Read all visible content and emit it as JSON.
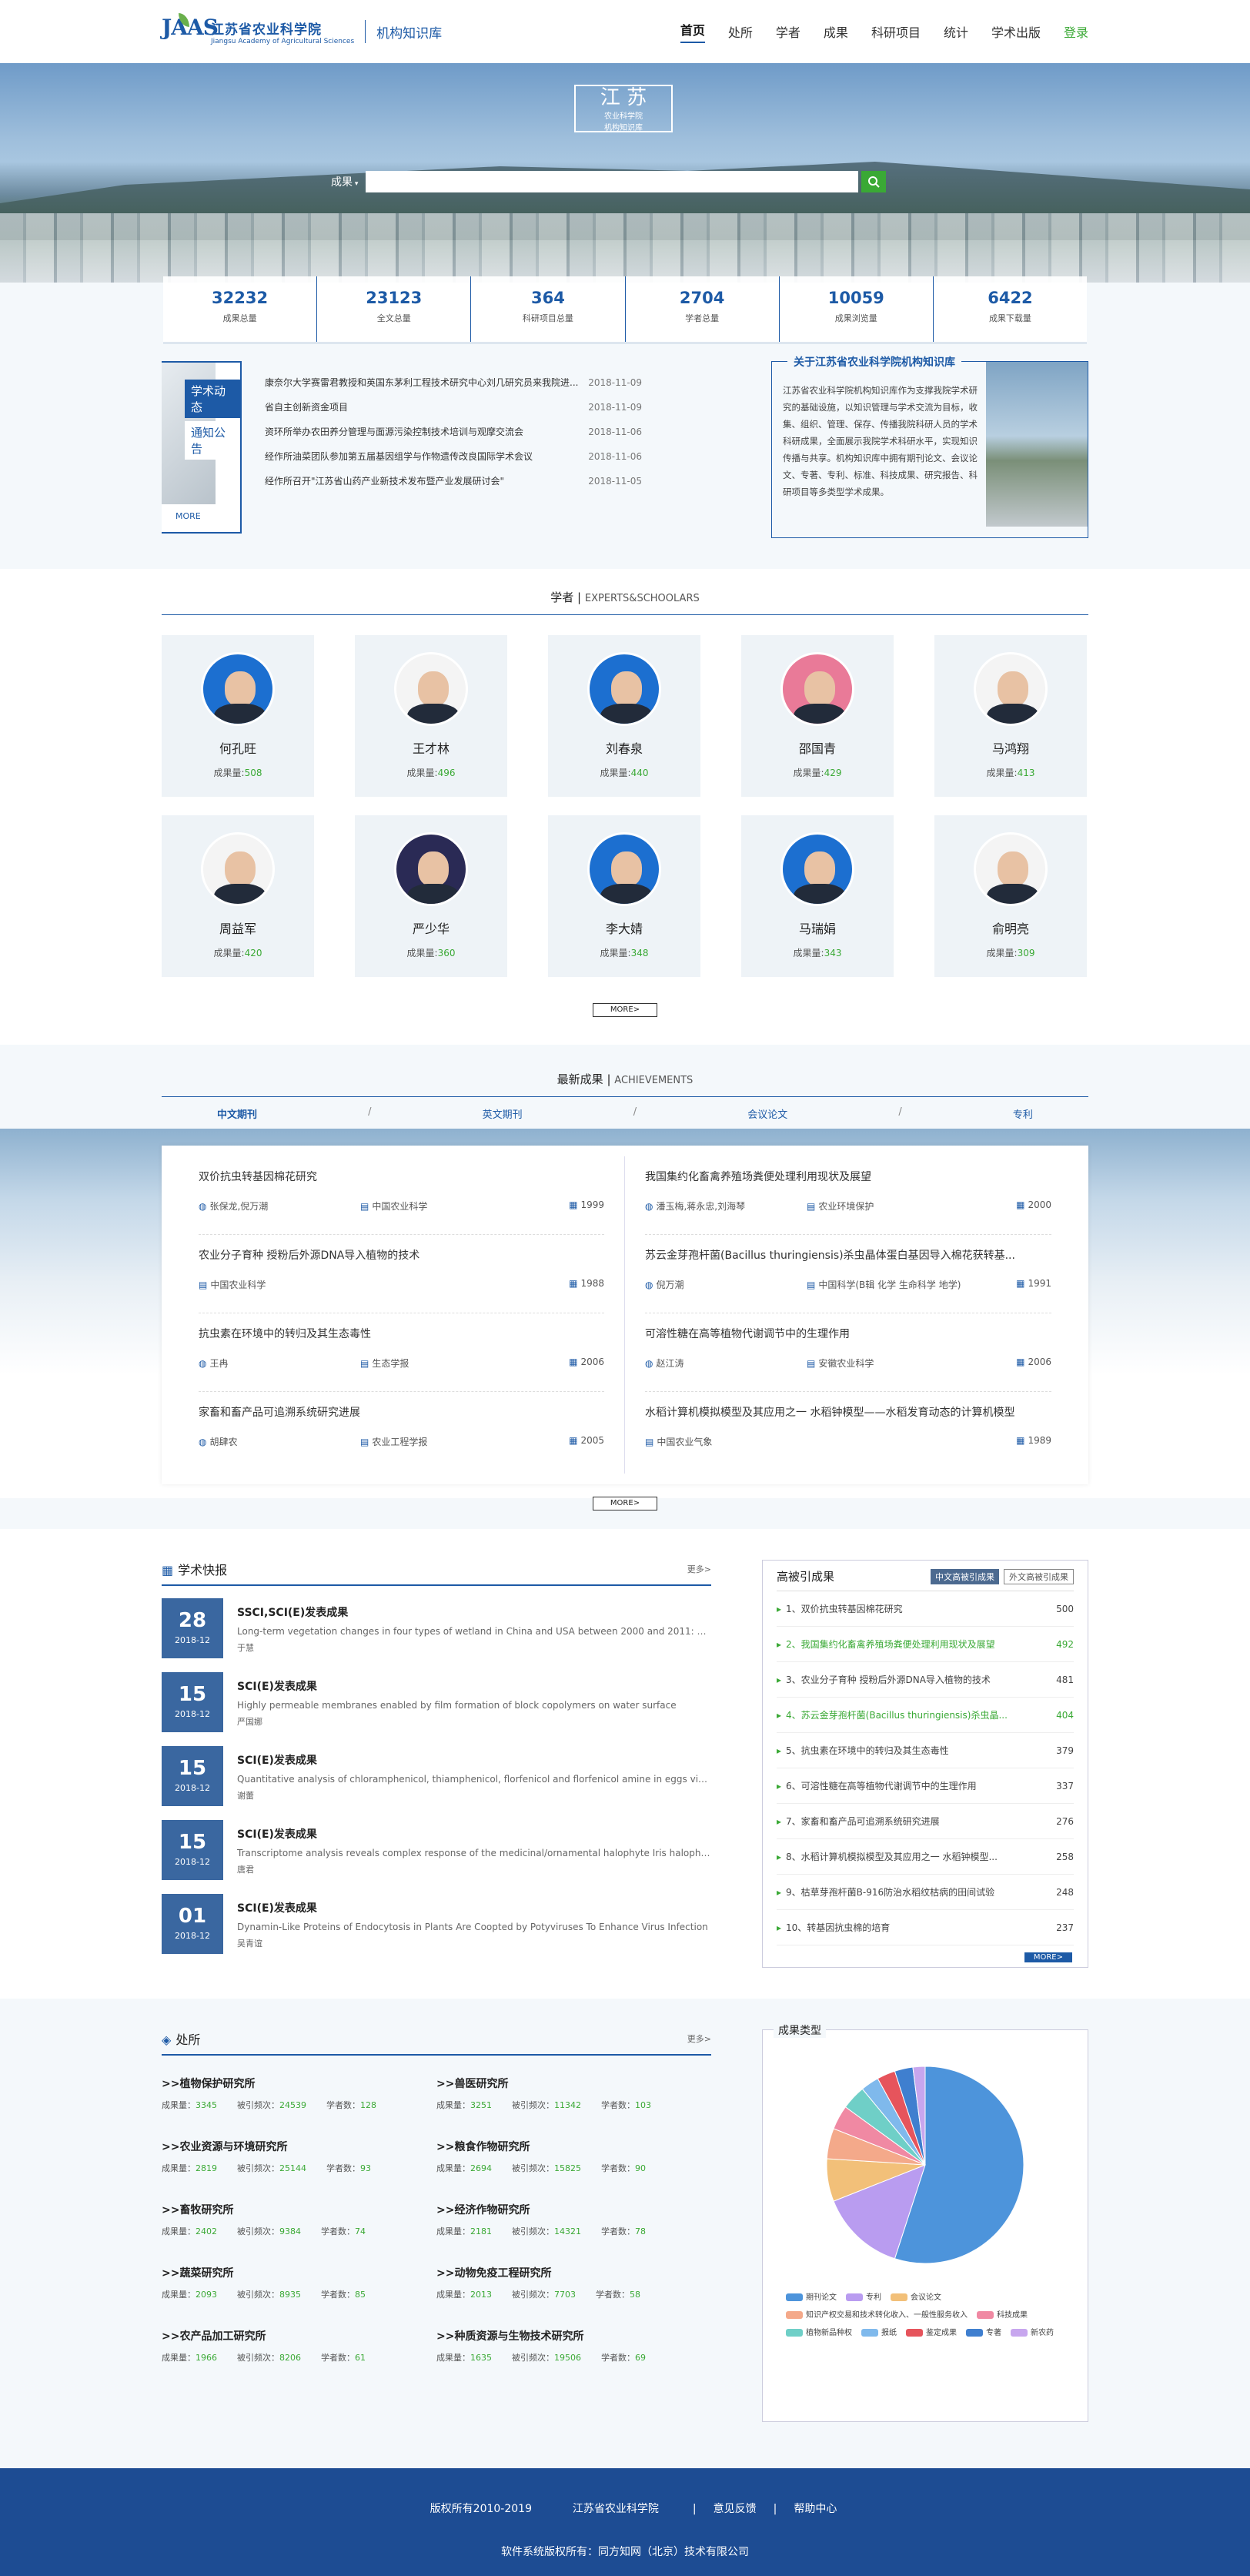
{
  "header": {
    "logo_mark": "JAAS",
    "logo_cn": "江苏省农业科学院",
    "logo_en": "Jiangsu Academy of Agricultural Sciences",
    "kb_name": "机构知识库",
    "nav": [
      "首页",
      "处所",
      "学者",
      "成果",
      "科研项目",
      "统计",
      "学术出版",
      "登录"
    ]
  },
  "banner": {
    "seal_main": "江  苏",
    "seal_sub1": "农业科学院",
    "seal_sub2": "机构知识库",
    "search_label": "成果",
    "search_placeholder": ""
  },
  "stats": [
    {
      "num": "32232",
      "label": "成果总量"
    },
    {
      "num": "23123",
      "label": "全文总量"
    },
    {
      "num": "364",
      "label": "科研项目总量"
    },
    {
      "num": "2704",
      "label": "学者总量"
    },
    {
      "num": "10059",
      "label": "成果浏览量"
    },
    {
      "num": "6422",
      "label": "成果下载量"
    }
  ],
  "news": {
    "tab1": "学术动态",
    "tab2": "通知公告",
    "more": "MORE",
    "items": [
      {
        "t": "康奈尔大学赛雷君教授和英国东茅利工程技术研究中心刘几研究员来我院进...",
        "d": "2018-11-09"
      },
      {
        "t": "省自主创新资金项目",
        "d": "2018-11-09"
      },
      {
        "t": "资环所举办农田养分管理与面源污染控制技术培训与观摩交流会",
        "d": "2018-11-06"
      },
      {
        "t": "经作所油菜团队参加第五届基因组学与作物遗传改良国际学术会议",
        "d": "2018-11-06"
      },
      {
        "t": "经作所召开\"江苏省山药产业新技术发布暨产业发展研讨会\"",
        "d": "2018-11-05"
      }
    ]
  },
  "about": {
    "title": "关于江苏省农业科学院机构知识库",
    "text": "江苏省农业科学院机构知识库作为支撑我院学术研究的基础设施，以知识管理与学术交流为目标，收集、组织、管理、保存、传播我院科研人员的学术科研成果，全面展示我院学术科研水平，实现知识传播与共享。机构知识库中拥有期刊论文、会议论文、专著、专利、标准、科技成果、研究报告、科研项目等多类型学术成果。"
  },
  "experts": {
    "title": "学者",
    "title_en": "EXPERTS&SCHOOLARS",
    "count_label": "成果量:",
    "more": "MORE>",
    "items": [
      {
        "name": "何孔旺",
        "count": "508"
      },
      {
        "name": "王才林",
        "count": "496"
      },
      {
        "name": "刘春泉",
        "count": "440"
      },
      {
        "name": "邵国青",
        "count": "429"
      },
      {
        "name": "马鸿翔",
        "count": "413"
      },
      {
        "name": "周益军",
        "count": "420"
      },
      {
        "name": "严少华",
        "count": "360"
      },
      {
        "name": "李大婧",
        "count": "348"
      },
      {
        "name": "马瑞娟",
        "count": "343"
      },
      {
        "name": "俞明亮",
        "count": "309"
      }
    ]
  },
  "achievements": {
    "title": "最新成果",
    "title_en": "ACHIEVEMENTS",
    "tabs": [
      "中文期刊",
      "英文期刊",
      "会议论文",
      "专利"
    ],
    "more": "MORE>",
    "left": [
      {
        "t": "双价抗虫转基因棉花研究",
        "au": "张保龙,倪万潮",
        "jr": "中国农业科学",
        "yr": "1999"
      },
      {
        "t": "农业分子育种 授粉后外源DNA导入植物的技术",
        "au": "",
        "jr": "中国农业科学",
        "yr": "1988"
      },
      {
        "t": "抗虫素在环境中的转归及其生态毒性",
        "au": "王冉",
        "jr": "生态学报",
        "yr": "2006"
      },
      {
        "t": "家畜和畜产品可追溯系统研究进展",
        "au": "胡肆农",
        "jr": "农业工程学报",
        "yr": "2005"
      }
    ],
    "right": [
      {
        "t": "我国集约化畜禽养殖场粪便处理利用现状及展望",
        "au": "潘玉梅,蒋永忠,刘海琴",
        "jr": "农业环境保护",
        "yr": "2000"
      },
      {
        "t": "苏云金芽孢杆菌(Bacillus thuringiensis)杀虫晶体蛋白基因导入棉花获转基...",
        "au": "倪万潮",
        "jr": "中国科学(B辑 化学 生命科学 地学)",
        "yr": "1991"
      },
      {
        "t": "可溶性糖在高等植物代谢调节中的生理作用",
        "au": "赵江涛",
        "jr": "安徽农业科学",
        "yr": "2006"
      },
      {
        "t": "水稻计算机模拟模型及其应用之一 水稻钟模型——水稻发育动态的计算机模型",
        "au": "",
        "jr": "中国农业气象",
        "yr": "1989"
      }
    ]
  },
  "bulletin": {
    "title": "学术快报",
    "more": "更多>",
    "items": [
      {
        "dd": "28",
        "ym": "2018-12",
        "h": "SSCI,SCI(E)发表成果",
        "p": "Long-term vegetation changes in four types of wetland in China and USA between 2000 and 2011: Ob...",
        "a": "于慧"
      },
      {
        "dd": "15",
        "ym": "2018-12",
        "h": "SCI(E)发表成果",
        "p": "Highly permeable membranes enabled by film formation of block copolymers on water surface",
        "a": "严国娜"
      },
      {
        "dd": "15",
        "ym": "2018-12",
        "h": "SCI(E)发表成果",
        "p": "Quantitative analysis of chloramphenicol, thiamphenicol, florfenicol and florfenicol amine in eggs via li...",
        "a": "谢蕾"
      },
      {
        "dd": "15",
        "ym": "2018-12",
        "h": "SCI(E)发表成果",
        "p": "Transcriptome analysis reveals complex response of the medicinal/ornamental halophyte Iris halophil...",
        "a": "唐君"
      },
      {
        "dd": "01",
        "ym": "2018-12",
        "h": "SCI(E)发表成果",
        "p": "Dynamin-Like Proteins of Endocytosis in Plants Are Coopted by Potyviruses To Enhance Virus Infection",
        "a": "吴青谊"
      }
    ]
  },
  "cited": {
    "title": "高被引成果",
    "tab1": "中文高被引成果",
    "tab2": "外文高被引成果",
    "more": "MORE>",
    "items": [
      {
        "n": "1、双价抗虫转基因棉花研究",
        "v": "500"
      },
      {
        "n": "2、我国集约化畜禽养殖场粪便处理利用现状及展望",
        "v": "492"
      },
      {
        "n": "3、农业分子育种 授粉后外源DNA导入植物的技术",
        "v": "481"
      },
      {
        "n": "4、苏云金芽孢杆菌(Bacillus thuringiensis)杀虫晶...",
        "v": "404"
      },
      {
        "n": "5、抗虫素在环境中的转归及其生态毒性",
        "v": "379"
      },
      {
        "n": "6、可溶性糖在高等植物代谢调节中的生理作用",
        "v": "337"
      },
      {
        "n": "7、家畜和畜产品可追溯系统研究进展",
        "v": "276"
      },
      {
        "n": "8、水稻计算机模拟模型及其应用之一 水稻钟模型...",
        "v": "258"
      },
      {
        "n": "9、枯草芽孢杆菌B-916防治水稻纹枯病的田间试验",
        "v": "248"
      },
      {
        "n": "10、转基因抗虫棉的培育",
        "v": "237"
      }
    ]
  },
  "departments": {
    "title": "处所",
    "more": "更多>",
    "l_count": "成果量：",
    "l_cited": "被引频次：",
    "l_scholars": "学者数：",
    "items": [
      {
        "n": ">>植物保护研究所",
        "c": "3345",
        "ci": "24539",
        "s": "128"
      },
      {
        "n": ">>兽医研究所",
        "c": "3251",
        "ci": "11342",
        "s": "103"
      },
      {
        "n": ">>农业资源与环境研究所",
        "c": "2819",
        "ci": "25144",
        "s": "93"
      },
      {
        "n": ">>粮食作物研究所",
        "c": "2694",
        "ci": "15825",
        "s": "90"
      },
      {
        "n": ">>畜牧研究所",
        "c": "2402",
        "ci": "9384",
        "s": "74"
      },
      {
        "n": ">>经济作物研究所",
        "c": "2181",
        "ci": "14321",
        "s": "78"
      },
      {
        "n": ">>蔬菜研究所",
        "c": "2093",
        "ci": "8935",
        "s": "85"
      },
      {
        "n": ">>动物免疫工程研究所",
        "c": "2013",
        "ci": "7703",
        "s": "58"
      },
      {
        "n": ">>农产品加工研究所",
        "c": "1966",
        "ci": "8206",
        "s": "61"
      },
      {
        "n": ">>种质资源与生物技术研究所",
        "c": "1635",
        "ci": "19506",
        "s": "69"
      }
    ]
  },
  "chart_data": {
    "type": "pie",
    "title": "成果类型",
    "categories": [
      "期刊论文",
      "专利",
      "会议论文",
      "知识产权交易和技术转化收入、一般性服务收入",
      "科技成果",
      "植物新品种权",
      "报纸",
      "鉴定成果",
      "专著",
      "新农药"
    ],
    "values": [
      55,
      14,
      7,
      5,
      4,
      4,
      3,
      3,
      3,
      2
    ],
    "colors": [
      "#4d94db",
      "#b99cf0",
      "#f2c079",
      "#f4a98a",
      "#f089a3",
      "#6fcfc7",
      "#7fb9ec",
      "#e6545c",
      "#3f7fcf",
      "#c7a6ee"
    ]
  },
  "footer": {
    "copyright": "版权所有2010-2019",
    "org": "江苏省农业科学院",
    "feedback": "意见反馈",
    "help": "帮助中心",
    "software": "软件系统版权所有：同方知网（北京）技术有限公司"
  }
}
